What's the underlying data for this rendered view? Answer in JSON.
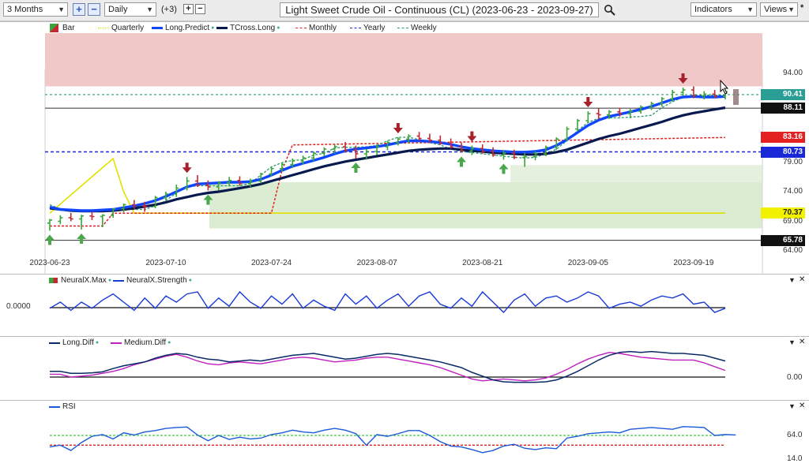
{
  "toolbar": {
    "range_value": "3 Months",
    "interval_value": "Daily",
    "offset_label": "(+3)",
    "plus": "+",
    "minus": "−",
    "chart_title": "Light Sweet Crude Oil - Continuous (CL) (2023-06-23 - 2023-09-27)",
    "indicators_label": "Indicators",
    "views_label": "Views",
    "star": "*"
  },
  "colors": {
    "up": "#3aa63a",
    "down": "#c42830",
    "long_predict": "#1146ff",
    "tcross_long": "#081a4d",
    "quarterly": "#e0e000",
    "monthly": "#e02020",
    "yearly": "#1a28d8",
    "weekly": "#2a9a6a",
    "green_zone": "#cfe6c3",
    "red_zone": "#f1c8c8",
    "neuralx_line": "#1a3ad8",
    "long_diff": "#0a2a66",
    "medium_diff": "#c020c0",
    "rsi": "#1a5ad8"
  },
  "chart_data": [
    {
      "type": "candlestick",
      "title": "Light Sweet Crude Oil - Continuous (CL) (2023-06-23 - 2023-09-27)",
      "legend": [
        "Bar",
        "Quarterly",
        "Long.Predict",
        "TCross.Long",
        "Monthly",
        "Yearly",
        "Weekly"
      ],
      "legend_placement": "top-left",
      "x_ticks": [
        "2023-06-23",
        "2023-07-10",
        "2023-07-24",
        "2023-08-07",
        "2023-08-21",
        "2023-09-05",
        "2023-09-19"
      ],
      "x_tick_index": [
        0,
        11,
        21,
        31,
        41,
        51,
        61
      ],
      "y_ticks": [
        64.0,
        69.0,
        74.0,
        79.0,
        94.0
      ],
      "ylim": [
        63.5,
        96.5
      ],
      "bars": [
        {
          "o": 68.7,
          "h": 69.4,
          "l": 67.4,
          "c": 69.2
        },
        {
          "o": 69.0,
          "h": 70.0,
          "l": 68.5,
          "c": 69.6
        },
        {
          "o": 69.6,
          "h": 70.4,
          "l": 69.0,
          "c": 69.4
        },
        {
          "o": 69.4,
          "h": 70.1,
          "l": 67.6,
          "c": 69.9
        },
        {
          "o": 69.9,
          "h": 70.6,
          "l": 69.2,
          "c": 69.8
        },
        {
          "o": 69.8,
          "h": 70.2,
          "l": 68.0,
          "c": 70.0
        },
        {
          "o": 70.0,
          "h": 71.2,
          "l": 69.6,
          "c": 71.1
        },
        {
          "o": 71.1,
          "h": 72.0,
          "l": 70.5,
          "c": 71.8
        },
        {
          "o": 71.8,
          "h": 72.6,
          "l": 71.1,
          "c": 71.6
        },
        {
          "o": 71.6,
          "h": 72.3,
          "l": 70.6,
          "c": 71.5
        },
        {
          "o": 71.5,
          "h": 73.3,
          "l": 71.2,
          "c": 73.0
        },
        {
          "o": 73.0,
          "h": 74.0,
          "l": 72.5,
          "c": 73.6
        },
        {
          "o": 73.6,
          "h": 75.2,
          "l": 73.1,
          "c": 74.6
        },
        {
          "o": 74.6,
          "h": 76.5,
          "l": 74.2,
          "c": 75.8
        },
        {
          "o": 75.8,
          "h": 76.8,
          "l": 74.8,
          "c": 75.1
        },
        {
          "o": 75.1,
          "h": 75.9,
          "l": 74.2,
          "c": 74.8
        },
        {
          "o": 74.8,
          "h": 75.8,
          "l": 74.2,
          "c": 75.5
        },
        {
          "o": 75.5,
          "h": 76.5,
          "l": 74.9,
          "c": 75.9
        },
        {
          "o": 75.9,
          "h": 76.6,
          "l": 75.0,
          "c": 75.4
        },
        {
          "o": 75.4,
          "h": 76.2,
          "l": 74.8,
          "c": 75.8
        },
        {
          "o": 75.8,
          "h": 77.2,
          "l": 75.4,
          "c": 77.0
        },
        {
          "o": 77.0,
          "h": 78.2,
          "l": 76.6,
          "c": 77.9
        },
        {
          "o": 77.9,
          "h": 78.9,
          "l": 77.4,
          "c": 78.6
        },
        {
          "o": 78.6,
          "h": 79.6,
          "l": 78.0,
          "c": 79.2
        },
        {
          "o": 79.2,
          "h": 80.1,
          "l": 78.6,
          "c": 79.7
        },
        {
          "o": 79.7,
          "h": 80.8,
          "l": 79.2,
          "c": 80.5
        },
        {
          "o": 80.5,
          "h": 81.5,
          "l": 80.0,
          "c": 81.2
        },
        {
          "o": 81.2,
          "h": 82.0,
          "l": 80.4,
          "c": 81.6
        },
        {
          "o": 81.6,
          "h": 82.4,
          "l": 80.6,
          "c": 81.0
        },
        {
          "o": 81.0,
          "h": 81.8,
          "l": 79.6,
          "c": 80.4
        },
        {
          "o": 80.4,
          "h": 81.2,
          "l": 79.4,
          "c": 80.8
        },
        {
          "o": 80.8,
          "h": 82.0,
          "l": 80.2,
          "c": 81.6
        },
        {
          "o": 81.6,
          "h": 82.6,
          "l": 81.0,
          "c": 82.3
        },
        {
          "o": 82.3,
          "h": 83.2,
          "l": 81.8,
          "c": 82.9
        },
        {
          "o": 82.9,
          "h": 83.7,
          "l": 82.2,
          "c": 83.4
        },
        {
          "o": 83.4,
          "h": 84.1,
          "l": 82.6,
          "c": 83.0
        },
        {
          "o": 83.0,
          "h": 83.8,
          "l": 82.2,
          "c": 82.7
        },
        {
          "o": 82.7,
          "h": 83.5,
          "l": 81.9,
          "c": 82.2
        },
        {
          "o": 82.2,
          "h": 83.0,
          "l": 81.3,
          "c": 81.6
        },
        {
          "o": 81.6,
          "h": 82.3,
          "l": 80.6,
          "c": 80.9
        },
        {
          "o": 80.9,
          "h": 81.8,
          "l": 80.2,
          "c": 81.3
        },
        {
          "o": 81.3,
          "h": 82.0,
          "l": 80.4,
          "c": 80.8
        },
        {
          "o": 80.8,
          "h": 81.5,
          "l": 79.9,
          "c": 80.2
        },
        {
          "o": 80.2,
          "h": 81.0,
          "l": 79.4,
          "c": 80.5
        },
        {
          "o": 80.5,
          "h": 81.1,
          "l": 79.5,
          "c": 79.8
        },
        {
          "o": 79.8,
          "h": 80.6,
          "l": 78.2,
          "c": 79.9
        },
        {
          "o": 79.9,
          "h": 80.8,
          "l": 79.3,
          "c": 80.4
        },
        {
          "o": 80.4,
          "h": 81.8,
          "l": 80.0,
          "c": 81.5
        },
        {
          "o": 81.5,
          "h": 83.2,
          "l": 81.1,
          "c": 82.9
        },
        {
          "o": 82.9,
          "h": 85.0,
          "l": 82.6,
          "c": 84.6
        },
        {
          "o": 84.6,
          "h": 86.3,
          "l": 84.2,
          "c": 86.0
        },
        {
          "o": 86.0,
          "h": 87.6,
          "l": 85.6,
          "c": 87.2
        },
        {
          "o": 87.2,
          "h": 88.1,
          "l": 86.2,
          "c": 87.0
        },
        {
          "o": 87.0,
          "h": 87.8,
          "l": 86.3,
          "c": 87.5
        },
        {
          "o": 87.5,
          "h": 88.2,
          "l": 86.7,
          "c": 87.2
        },
        {
          "o": 87.2,
          "h": 88.0,
          "l": 86.4,
          "c": 87.6
        },
        {
          "o": 87.6,
          "h": 88.6,
          "l": 87.2,
          "c": 88.3
        },
        {
          "o": 88.3,
          "h": 89.2,
          "l": 87.8,
          "c": 88.9
        },
        {
          "o": 88.9,
          "h": 90.0,
          "l": 88.4,
          "c": 89.7
        },
        {
          "o": 89.7,
          "h": 91.2,
          "l": 89.2,
          "c": 90.8
        },
        {
          "o": 90.8,
          "h": 91.6,
          "l": 90.2,
          "c": 91.2
        },
        {
          "o": 91.2,
          "h": 91.8,
          "l": 89.8,
          "c": 90.2
        },
        {
          "o": 90.2,
          "h": 91.0,
          "l": 89.6,
          "c": 90.5
        },
        {
          "o": 90.5,
          "h": 91.2,
          "l": 89.8,
          "c": 90.1
        },
        {
          "o": 90.1,
          "h": 91.2,
          "l": 89.6,
          "c": 90.9
        }
      ],
      "long_predict": [
        71.4,
        71.0,
        70.9,
        70.8,
        70.8,
        70.9,
        71.0,
        71.3,
        71.6,
        72.0,
        72.5,
        73.2,
        74.0,
        74.8,
        75.3,
        75.4,
        75.5,
        75.6,
        75.6,
        75.7,
        76.1,
        76.8,
        77.6,
        78.3,
        78.8,
        79.3,
        79.8,
        80.4,
        80.9,
        81.2,
        81.4,
        81.6,
        81.9,
        82.3,
        82.6,
        82.6,
        82.5,
        82.3,
        82.0,
        81.6,
        81.3,
        81.1,
        80.9,
        80.8,
        80.7,
        80.7,
        80.8,
        81.1,
        81.8,
        82.8,
        84.0,
        85.2,
        86.1,
        86.7,
        87.1,
        87.5,
        87.9,
        88.4,
        89.0,
        89.6,
        90.0,
        90.1,
        90.0,
        90.0,
        90.1
      ],
      "tcross_long": [
        71.2,
        71.0,
        70.8,
        70.7,
        70.7,
        70.7,
        70.8,
        71.0,
        71.2,
        71.5,
        71.8,
        72.2,
        72.7,
        73.1,
        73.5,
        73.8,
        74.0,
        74.3,
        74.6,
        74.9,
        75.3,
        75.8,
        76.3,
        76.8,
        77.3,
        77.8,
        78.3,
        78.7,
        79.1,
        79.4,
        79.7,
        80.0,
        80.3,
        80.6,
        80.9,
        81.1,
        81.2,
        81.3,
        81.3,
        81.1,
        80.9,
        80.8,
        80.6,
        80.5,
        80.4,
        80.3,
        80.3,
        80.4,
        80.7,
        81.1,
        81.7,
        82.3,
        82.9,
        83.4,
        83.8,
        84.3,
        84.8,
        85.3,
        85.8,
        86.4,
        86.9,
        87.3,
        87.6,
        87.9,
        88.2
      ],
      "weekly": [
        71.8,
        71.1,
        70.9,
        70.9,
        70.9,
        70.9,
        71.0,
        71.0,
        71.0,
        71.0,
        71.6,
        72.5,
        73.8,
        74.8,
        75.0,
        75.0,
        75.0,
        75.0,
        75.0,
        75.4,
        76.8,
        78.2,
        78.9,
        79.3,
        79.4,
        80.2,
        80.5,
        81.4,
        81.5,
        81.5,
        81.6,
        81.8,
        82.6,
        83.2,
        83.2,
        82.8,
        82.3,
        81.9,
        81.2,
        80.8,
        80.6,
        80.4,
        80.2,
        80.0,
        79.8,
        79.7,
        79.8,
        80.4,
        81.2,
        82.6,
        84.3,
        85.7,
        86.4,
        86.5,
        86.5,
        86.6,
        86.7,
        86.9,
        88.2,
        89.2,
        90.0,
        90.3,
        90.3,
        90.3,
        90.3
      ],
      "quarterly_x": [
        0,
        6,
        7,
        8,
        64
      ],
      "quarterly_y": [
        70.37,
        79.6,
        74.0,
        70.37,
        70.37
      ],
      "monthly_x": [
        0,
        5,
        6,
        21,
        22,
        23,
        64
      ],
      "monthly_y": [
        68.2,
        68.2,
        70.37,
        70.37,
        77.6,
        81.9,
        83.16
      ],
      "yearly": 80.73,
      "levels": {
        "level_88": 88.11,
        "level_66": 65.78,
        "price": 90.41
      },
      "y_tags": [
        "94.00",
        "90.41",
        "88.11",
        "83.16",
        "80.73",
        "79.00",
        "74.00",
        "70.37",
        "69.00",
        "65.78",
        "64.00"
      ],
      "up_signals": [
        0,
        3,
        15,
        29,
        39,
        43
      ],
      "down_signals": [
        13,
        33,
        40,
        51,
        60
      ]
    },
    {
      "type": "line",
      "legend": [
        "NeuralX.Max",
        "NeuralX.Strength"
      ],
      "y_tick": "0.0000",
      "values": [
        0.2,
        0.5,
        0.1,
        0.5,
        0.2,
        0.6,
        0.9,
        0.5,
        0.1,
        0.7,
        0.2,
        0.8,
        0.5,
        0.9,
        1.0,
        0.2,
        0.7,
        0.3,
        1.0,
        0.5,
        0.2,
        0.8,
        0.4,
        0.9,
        0.2,
        0.6,
        0.3,
        0.1,
        0.9,
        0.4,
        0.8,
        0.2,
        0.6,
        0.9,
        0.3,
        0.8,
        1.0,
        0.4,
        0.2,
        0.7,
        0.3,
        1.0,
        0.5,
        0.0,
        0.6,
        0.9,
        0.3,
        0.7,
        0.8,
        0.5,
        0.7,
        1.0,
        0.8,
        0.2,
        0.4,
        0.5,
        0.3,
        0.6,
        0.8,
        0.7,
        0.9,
        0.4,
        0.5,
        0.0,
        0.2
      ],
      "strip": [
        "down",
        "yellow",
        "down",
        "up",
        "up",
        "up",
        "up",
        "up",
        "up",
        "up",
        "up",
        "up",
        "up",
        "up",
        "up",
        "up",
        "up",
        "down",
        "down",
        "up",
        "up",
        "up",
        "up",
        "up",
        "up",
        "up",
        "up",
        "down",
        "up",
        "up",
        "up",
        "up",
        "up",
        "down",
        "up",
        "up",
        "yellow",
        "up",
        "up",
        "yellow",
        "up",
        "up",
        "down",
        "down",
        "down",
        "down",
        "down",
        "down",
        "up",
        "up",
        "down",
        "down",
        "down",
        "up",
        "up",
        "up",
        "up",
        "up",
        "up",
        "up",
        "up",
        "up",
        "up",
        "up",
        "up",
        "yellow",
        "up",
        "up",
        "up",
        "up",
        "up",
        "up",
        "up",
        "up",
        "up",
        "down",
        "down",
        "yellow"
      ]
    },
    {
      "type": "line",
      "legend": [
        "Long.Diff",
        "Medium.Diff"
      ],
      "y_tick": "0.00",
      "long_diff": [
        0.6,
        0.6,
        0.4,
        0.4,
        0.45,
        0.55,
        0.9,
        1.2,
        1.4,
        1.6,
        2.0,
        2.3,
        2.5,
        2.4,
        2.1,
        1.9,
        1.8,
        1.6,
        1.7,
        1.8,
        1.7,
        1.9,
        2.1,
        2.3,
        2.4,
        2.5,
        2.3,
        2.1,
        1.9,
        2.0,
        2.2,
        2.4,
        2.5,
        2.4,
        2.2,
        2.0,
        1.8,
        1.6,
        1.3,
        1.0,
        0.5,
        0.1,
        -0.3,
        -0.5,
        -0.55,
        -0.55,
        -0.55,
        -0.5,
        -0.3,
        0.1,
        0.6,
        1.2,
        1.8,
        2.3,
        2.6,
        2.7,
        2.6,
        2.7,
        2.6,
        2.5,
        2.5,
        2.4,
        2.3,
        2.0,
        1.7
      ],
      "medium_diff": [
        0.3,
        0.3,
        0.0,
        0.1,
        0.2,
        0.4,
        0.6,
        0.9,
        1.3,
        1.6,
        1.9,
        2.2,
        2.4,
        2.1,
        1.7,
        1.4,
        1.3,
        1.5,
        1.6,
        1.5,
        1.4,
        1.6,
        1.8,
        2.0,
        2.1,
        2.0,
        1.8,
        1.6,
        1.7,
        1.8,
        2.0,
        2.1,
        2.1,
        1.9,
        1.7,
        1.5,
        1.3,
        1.0,
        0.6,
        0.2,
        -0.2,
        -0.4,
        -0.3,
        -0.2,
        -0.3,
        -0.4,
        -0.3,
        -0.1,
        0.3,
        0.8,
        1.4,
        1.9,
        2.3,
        2.6,
        2.5,
        2.3,
        2.1,
        2.0,
        1.9,
        1.8,
        1.8,
        1.8,
        1.5,
        1.1,
        0.7
      ]
    },
    {
      "type": "line",
      "legend": [
        "RSI"
      ],
      "y_ticks": [
        "64.0",
        "14.0"
      ],
      "values": [
        38,
        42,
        30,
        48,
        62,
        66,
        56,
        70,
        65,
        72,
        75,
        80,
        82,
        83,
        65,
        52,
        64,
        55,
        60,
        56,
        58,
        66,
        70,
        76,
        72,
        70,
        76,
        80,
        76,
        68,
        42,
        66,
        62,
        68,
        75,
        75,
        64,
        50,
        40,
        38,
        32,
        25,
        30,
        40,
        44,
        35,
        32,
        36,
        34,
        58,
        62,
        68,
        70,
        72,
        70,
        78,
        80,
        82,
        80,
        78,
        84,
        83,
        82,
        64,
        66,
        65
      ],
      "green_ref": 64.0,
      "red_ref": 42.0
    }
  ]
}
